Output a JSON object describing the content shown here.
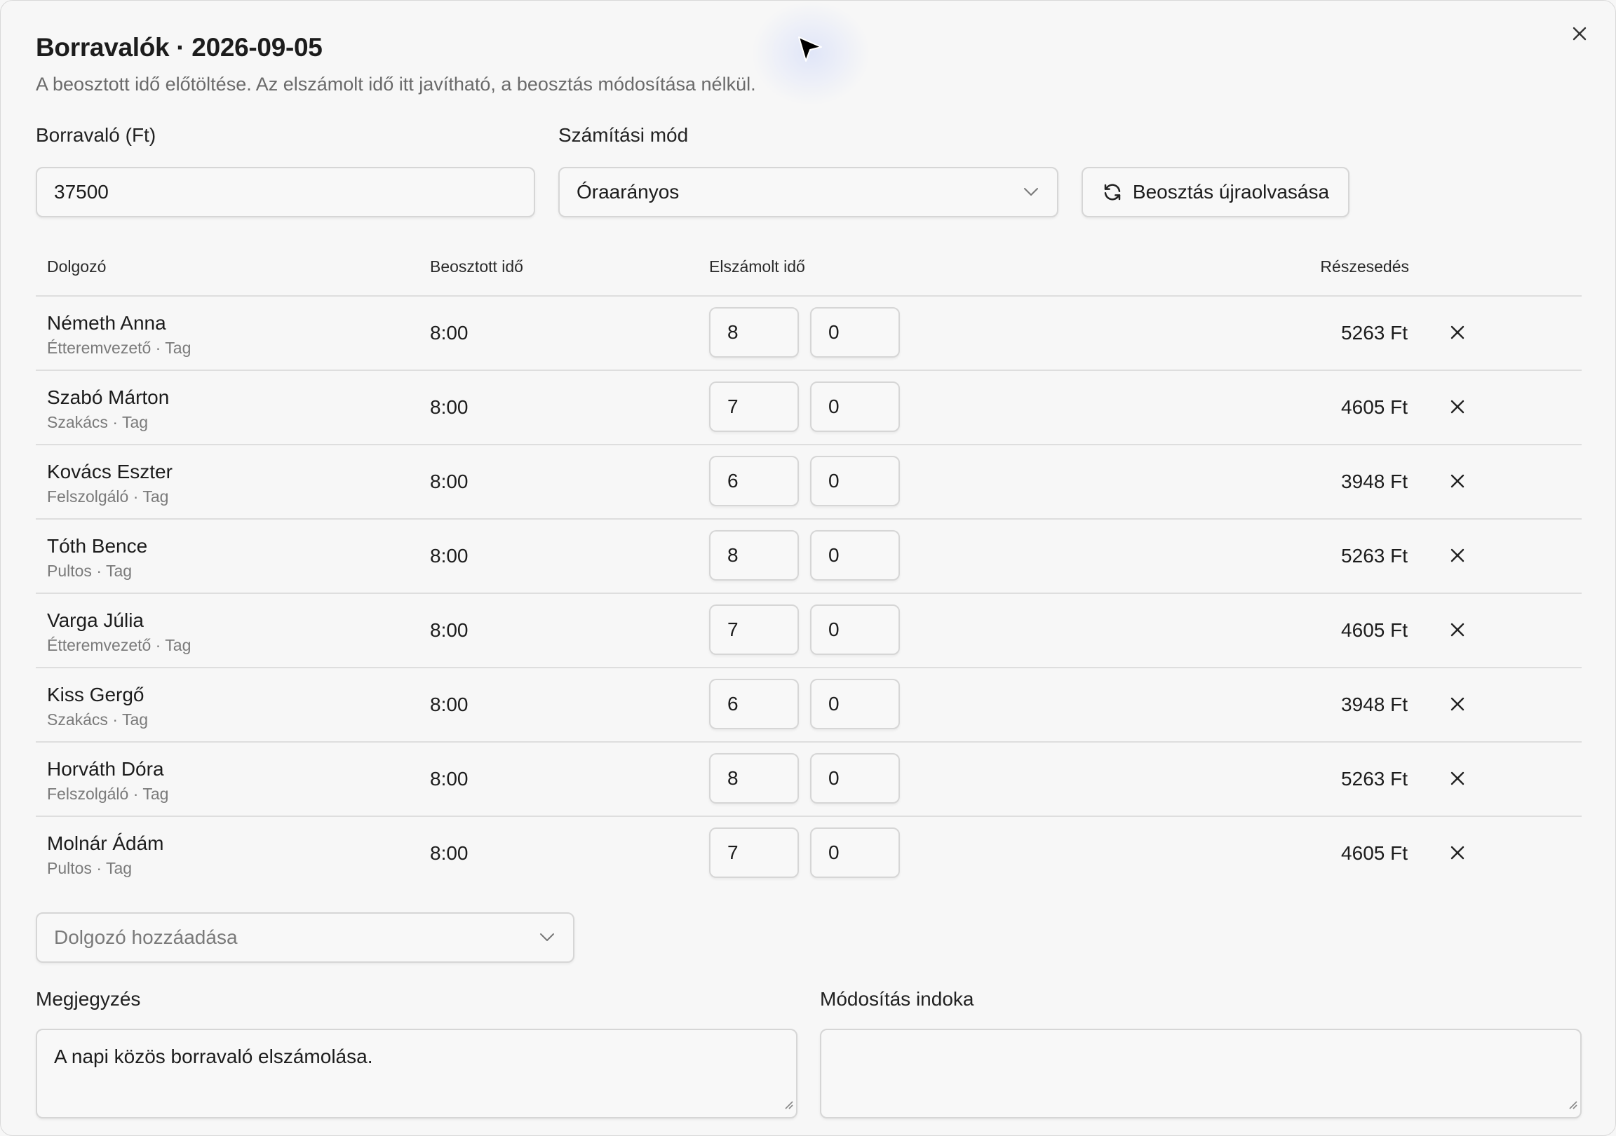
{
  "dialog": {
    "title": "Borravalók · 2026-09-05",
    "subtitle": "A beosztott idő előtöltése. Az elszámolt idő itt javítható, a beosztás módosítása nélkül."
  },
  "form": {
    "tip_label": "Borravaló (Ft)",
    "tip_value": "37500",
    "method_label": "Számítási mód",
    "method_value": "Óraarányos",
    "reload_button": "Beosztás újraolvasása"
  },
  "table": {
    "headers": {
      "employee": "Dolgozó",
      "scheduled": "Beosztott idő",
      "billed": "Elszámolt idő",
      "share": "Részesedés"
    },
    "rows": [
      {
        "name": "Németh Anna",
        "role": "Étteremvezető · Tag",
        "scheduled": "8:00",
        "hours": "8",
        "minutes": "0",
        "share": "5263 Ft"
      },
      {
        "name": "Szabó Márton",
        "role": "Szakács · Tag",
        "scheduled": "8:00",
        "hours": "7",
        "minutes": "0",
        "share": "4605 Ft"
      },
      {
        "name": "Kovács Eszter",
        "role": "Felszolgáló · Tag",
        "scheduled": "8:00",
        "hours": "6",
        "minutes": "0",
        "share": "3948 Ft"
      },
      {
        "name": "Tóth Bence",
        "role": "Pultos · Tag",
        "scheduled": "8:00",
        "hours": "8",
        "minutes": "0",
        "share": "5263 Ft"
      },
      {
        "name": "Varga Júlia",
        "role": "Étteremvezető · Tag",
        "scheduled": "8:00",
        "hours": "7",
        "minutes": "0",
        "share": "4605 Ft"
      },
      {
        "name": "Kiss Gergő",
        "role": "Szakács · Tag",
        "scheduled": "8:00",
        "hours": "6",
        "minutes": "0",
        "share": "3948 Ft"
      },
      {
        "name": "Horváth Dóra",
        "role": "Felszolgáló · Tag",
        "scheduled": "8:00",
        "hours": "8",
        "minutes": "0",
        "share": "5263 Ft"
      },
      {
        "name": "Molnár Ádám",
        "role": "Pultos · Tag",
        "scheduled": "8:00",
        "hours": "7",
        "minutes": "0",
        "share": "4605 Ft"
      }
    ]
  },
  "add_employee": {
    "placeholder": "Dolgozó hozzáadása"
  },
  "notes": {
    "note_label": "Megjegyzés",
    "note_value": "A napi közös borravaló elszámolása.",
    "reason_label": "Módosítás indoka",
    "reason_value": ""
  },
  "icons": {
    "close": "close-icon",
    "chevron": "chevron-down-icon",
    "refresh": "refresh-icon",
    "remove": "remove-row-icon"
  }
}
